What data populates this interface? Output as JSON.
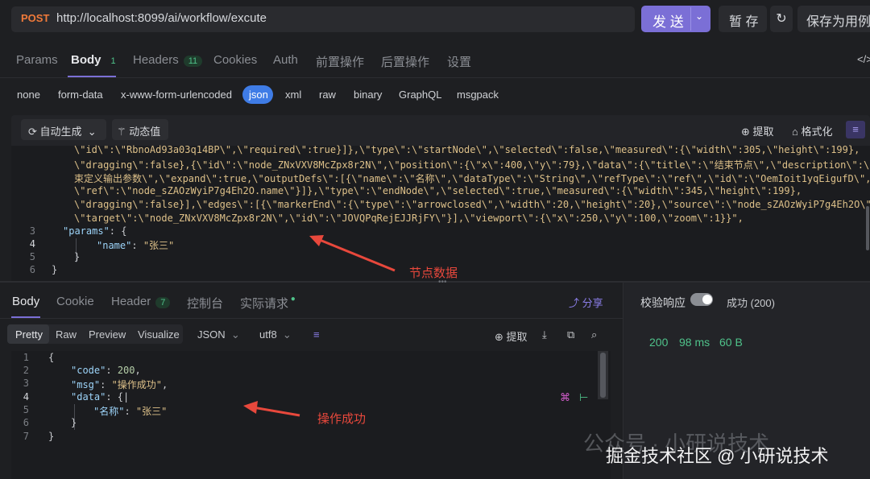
{
  "request": {
    "method": "POST",
    "url": "http://localhost:8099/ai/workflow/excute",
    "send_label": "发 送",
    "save_label": "暂 存",
    "save_example_label": "保存为用例"
  },
  "req_tabs": [
    {
      "label": "Params"
    },
    {
      "label": "Body",
      "badge": "1"
    },
    {
      "label": "Headers",
      "badge": "11"
    },
    {
      "label": "Cookies"
    },
    {
      "label": "Auth"
    },
    {
      "label": "前置操作"
    },
    {
      "label": "后置操作"
    },
    {
      "label": "设置"
    }
  ],
  "body_types": [
    "none",
    "form-data",
    "x-www-form-urlencoded",
    "json",
    "xml",
    "raw",
    "binary",
    "GraphQL",
    "msgpack"
  ],
  "editor_toolbar": {
    "auto_generate": "自动生成",
    "dynamic_value": "动态值",
    "extract": "提取",
    "format": "格式化"
  },
  "request_code": {
    "wrapped_lines": [
      "\\\"id\\\":\\\"RbnoAd93a03q14BP\\\",\\\"required\\\":true}]},\\\"type\\\":\\\"startNode\\\",\\\"selected\\\":false,\\\"measured\\\":{\\\"width\\\":305,\\\"height\\\":199},",
      "\\\"dragging\\\":false},{\\\"id\\\":\\\"node_ZNxVXV8McZpx8r2N\\\",\\\"position\\\":{\\\"x\\\":400,\\\"y\\\":79},\\\"data\\\":{\\\"title\\\":\\\"结束节点\\\",\\\"description\\\":\\\"结",
      "束定义输出参数\\\",\\\"expand\\\":true,\\\"outputDefs\\\":[{\\\"name\\\":\\\"名称\\\",\\\"dataType\\\":\\\"String\\\",\\\"refType\\\":\\\"ref\\\",\\\"id\\\":\\\"OemIoit1yqEigufD\\\",",
      "\\\"ref\\\":\\\"node_sZAOzWyiP7g4Eh2O.name\\\"}]},\\\"type\\\":\\\"endNode\\\",\\\"selected\\\":true,\\\"measured\\\":{\\\"width\\\":345,\\\"height\\\":199},",
      "\\\"dragging\\\":false}],\\\"edges\\\":[{\\\"markerEnd\\\":{\\\"type\\\":\\\"arrowclosed\\\",\\\"width\\\":20,\\\"height\\\":20},\\\"source\\\":\\\"node_sZAOzWyiP7g4Eh2O\\\",",
      "\\\"target\\\":\\\"node_ZNxVXV8McZpx8r2N\\\",\\\"id\\\":\\\"JOVQPqRejEJJRjFY\\\"}],\\\"viewport\\\":{\\\"x\\\":250,\\\"y\\\":100,\\\"zoom\\\":1}}\","
    ],
    "line3_key": "\"params\"",
    "line3_rest": ": {",
    "line4_key": "\"name\"",
    "line4_val": "\"张三\"",
    "line5": "}",
    "line6": "}",
    "line_numbers": [
      "3",
      "4",
      "5",
      "6"
    ]
  },
  "response": {
    "tabs": [
      {
        "label": "Body"
      },
      {
        "label": "Cookie"
      },
      {
        "label": "Header",
        "badge": "7"
      },
      {
        "label": "控制台"
      },
      {
        "label": "实际请求"
      }
    ],
    "share": "分享",
    "views": [
      "Pretty",
      "Raw",
      "Preview",
      "Visualize"
    ],
    "format": "JSON",
    "encoding": "utf8",
    "extract": "提取",
    "code": {
      "open": "{",
      "code_key": "\"code\"",
      "code_val": "200",
      "msg_key": "\"msg\"",
      "msg_val": "\"操作成功\"",
      "data_key": "\"data\"",
      "name_key": "\"名称\"",
      "name_val": "\"张三\"",
      "close_inner": "}",
      "close": "}"
    },
    "line_numbers": [
      "1",
      "2",
      "3",
      "4",
      "5",
      "6",
      "7"
    ]
  },
  "validation": {
    "label": "校验响应",
    "status": "成功 (200)",
    "code": "200",
    "time": "98 ms",
    "size": "60 B"
  },
  "annotations": {
    "node_data": "节点数据",
    "op_success": "操作成功"
  },
  "watermark": {
    "top": "公众号 · 小研说技术",
    "bottom": "掘金技术社区 @ 小研说技术"
  }
}
